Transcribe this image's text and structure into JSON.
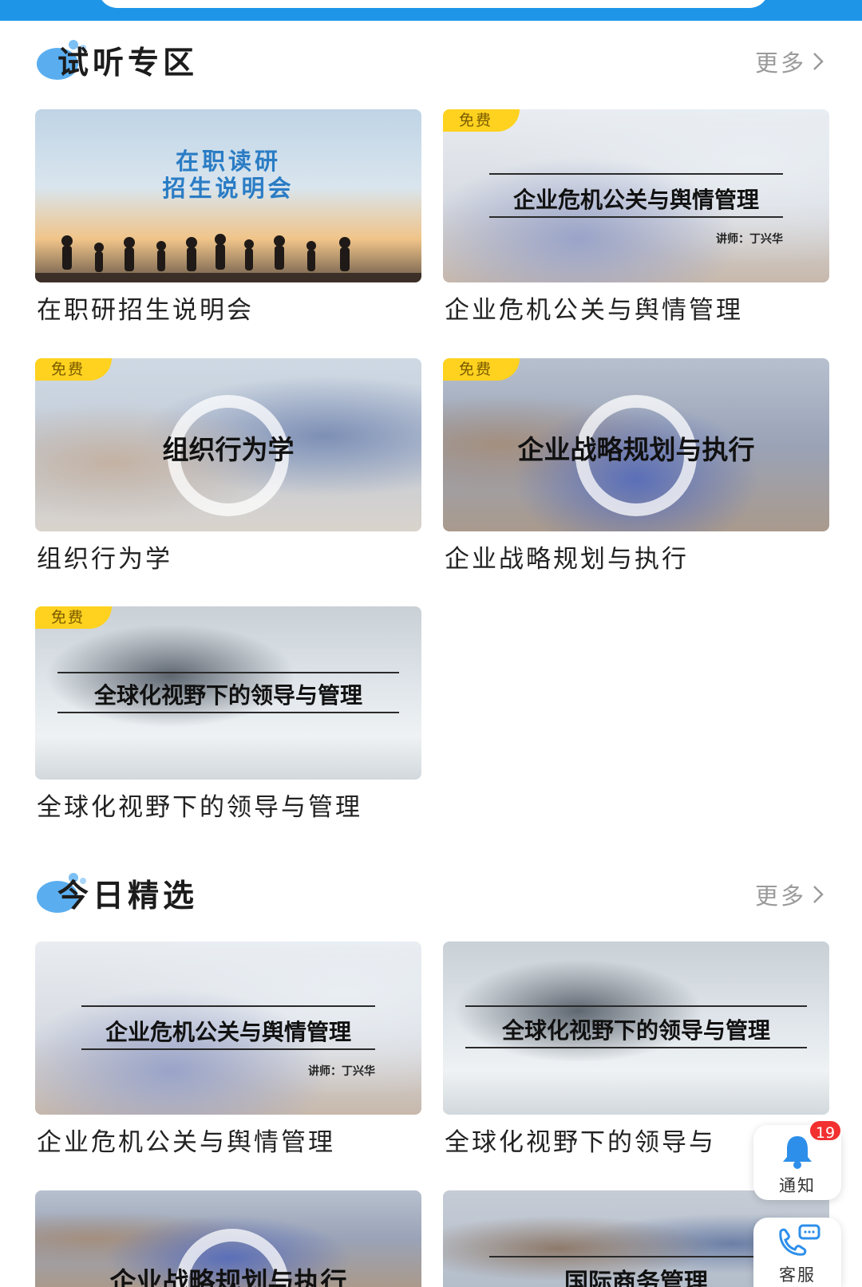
{
  "sections": [
    {
      "title": "试听专区",
      "more": "更多",
      "cards": [
        {
          "thumb_lines": [
            "在职读研",
            "招生说明会"
          ],
          "badge": "",
          "caption": "在职研招生说明会"
        },
        {
          "thumb_title": "企业危机公关与舆情管理",
          "thumb_sub": "讲师：丁兴华",
          "badge": "免费",
          "caption": "企业危机公关与舆情管理"
        },
        {
          "thumb_title": "组织行为学",
          "badge": "免费",
          "caption": "组织行为学"
        },
        {
          "thumb_title": "企业战略规划与执行",
          "badge": "免费",
          "caption": "企业战略规划与执行"
        },
        {
          "thumb_title": "全球化视野下的领导与管理",
          "badge": "免费",
          "caption": "全球化视野下的领导与管理"
        }
      ]
    },
    {
      "title": "今日精选",
      "more": "更多",
      "cards": [
        {
          "thumb_title": "企业危机公关与舆情管理",
          "thumb_sub": "讲师：丁兴华",
          "caption": "企业危机公关与舆情管理"
        },
        {
          "thumb_title": "全球化视野下的领导与管理",
          "caption": "全球化视野下的领导与"
        },
        {
          "thumb_title": "企业战略规划与执行",
          "caption": ""
        },
        {
          "thumb_title": "国际商务管理",
          "caption": ""
        }
      ]
    }
  ],
  "floating": {
    "notify_label": "通知",
    "notify_count": "19",
    "service_label": "客服"
  },
  "colors": {
    "brand_blue": "#1f95e8",
    "badge_yellow": "#ffd21f",
    "notify_red": "#f23030"
  },
  "icons": [
    "bubble-deco-icon",
    "chevron-right-icon",
    "bell-icon",
    "headset-icon"
  ]
}
